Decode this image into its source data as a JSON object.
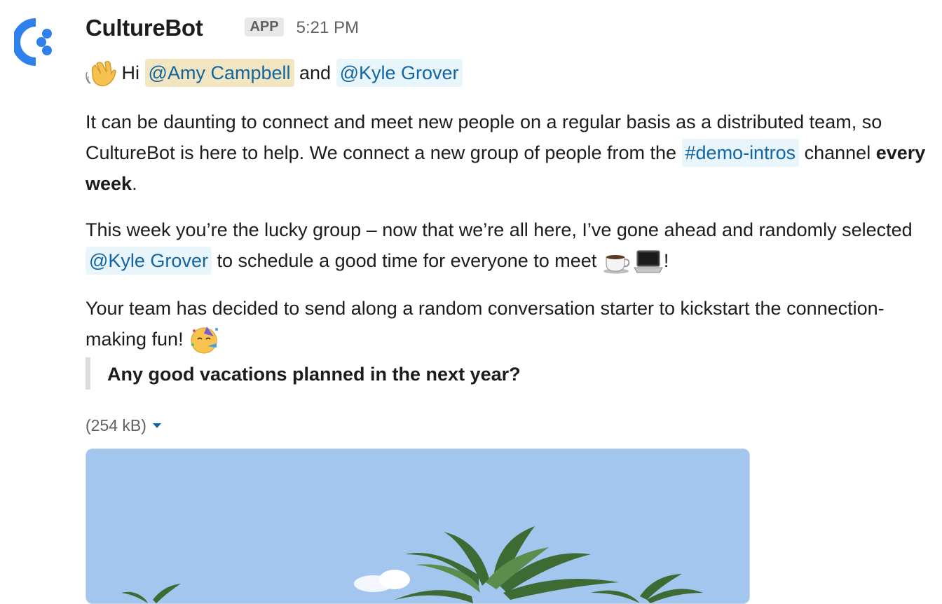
{
  "message": {
    "author": "CultureBot",
    "badge": "APP",
    "timestamp": "5:21 PM",
    "greeting": {
      "prefix": "Hi",
      "mention_1": "@Amy Campbell",
      "conjunction": "and",
      "mention_2": "@Kyle Grover"
    },
    "paragraph_1": {
      "text_a": "It can be daunting to connect and meet new people on a regular basis as a distributed team, so CultureBot is here to help. We connect a new group of people from the",
      "channel": "#demo-intros",
      "text_b": "channel",
      "bold": "every week",
      "text_c": "."
    },
    "paragraph_2": {
      "text_a": "This week you’re the lucky group – now that we’re all here, I’ve gone ahead and randomly selected",
      "mention": "@Kyle Grover",
      "text_b": "to schedule a good time for everyone to meet",
      "text_c": "!"
    },
    "paragraph_3": {
      "text": "Your team has decided to send along a random conversation starter to kickstart the connection-making fun!"
    },
    "quote": "Any good vacations planned in the next year?",
    "attachment": {
      "size": "(254 kB)"
    }
  },
  "icons": {
    "avatar": "culturebot-logo-icon",
    "wave": "waving-hand-icon",
    "coffee": "coffee-icon",
    "laptop": "laptop-icon",
    "party": "partying-face-icon",
    "caret": "caret-down-icon"
  },
  "colors": {
    "brand_blue": "#2f80ed",
    "link": "#1264a3",
    "mention_bg": "#e8f5fa",
    "self_mention_bg": "#f2e6c0",
    "sky": "#a3c6ef"
  }
}
